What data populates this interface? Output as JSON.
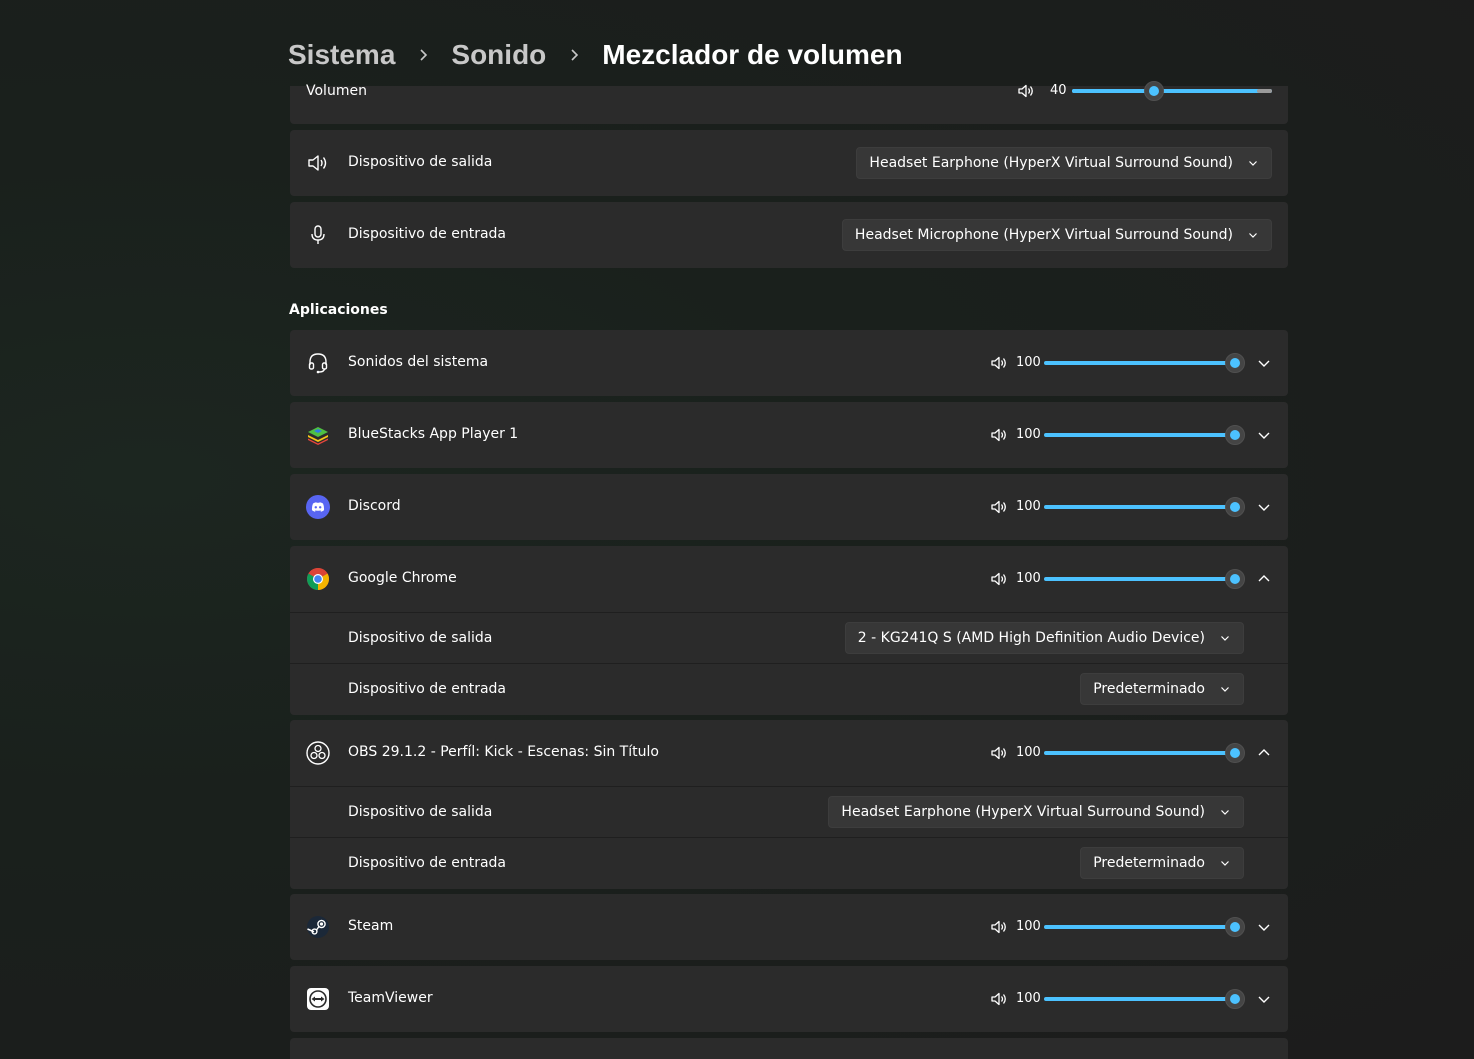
{
  "breadcrumb": {
    "level1": "Sistema",
    "level2": "Sonido",
    "current": "Mezclador de volumen"
  },
  "system": {
    "volume_label": "Volumen",
    "volume_value": "40",
    "volume_level": 0.4,
    "output_label": "Dispositivo de salida",
    "output_device": "Headset Earphone (HyperX Virtual Surround Sound)",
    "input_label": "Dispositivo de entrada",
    "input_device": "Headset Microphone (HyperX Virtual Surround Sound)"
  },
  "apps_title": "Aplicaciones",
  "apps": [
    {
      "name": "Sonidos del sistema",
      "volume": "100",
      "expanded": false,
      "icon": "headset-icon"
    },
    {
      "name": "BlueStacks App Player 1",
      "volume": "100",
      "expanded": false,
      "icon": "bluestacks-icon"
    },
    {
      "name": "Discord",
      "volume": "100",
      "expanded": false,
      "icon": "discord-icon"
    },
    {
      "name": "Google Chrome",
      "volume": "100",
      "expanded": true,
      "icon": "chrome-icon",
      "output_label": "Dispositivo de salida",
      "output_device": "2 - KG241Q S (AMD High Definition Audio Device)",
      "input_label": "Dispositivo de entrada",
      "input_device": "Predeterminado"
    },
    {
      "name": "OBS 29.1.2 - Perfíl: Kick - Escenas: Sin Título",
      "volume": "100",
      "expanded": true,
      "icon": "obs-icon",
      "output_label": "Dispositivo de salida",
      "output_device": "Headset Earphone (HyperX Virtual Surround Sound)",
      "input_label": "Dispositivo de entrada",
      "input_device": "Predeterminado"
    },
    {
      "name": "Steam",
      "volume": "100",
      "expanded": false,
      "icon": "steam-icon"
    },
    {
      "name": "TeamViewer",
      "volume": "100",
      "expanded": false,
      "icon": "teamviewer-icon"
    }
  ],
  "colors": {
    "accent": "#4cc2ff",
    "card": "#2b2b2b",
    "background": "#1c1c1c"
  }
}
